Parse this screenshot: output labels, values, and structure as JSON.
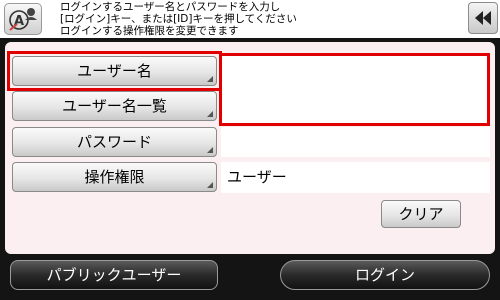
{
  "header": {
    "icon": "user-login-icon",
    "lines": [
      "ログインするユーザー名とパスワードを入力し",
      "[ログイン]キー、または[ID]キーを押してください",
      "ログインする操作権限を変更できます"
    ],
    "back_icon": "double-left-arrow-icon"
  },
  "form": {
    "username_button": "ユーザー名",
    "userlist_button": "ユーザー名一覧",
    "password_button": "パスワード",
    "authority_button": "操作権限",
    "username_value": "",
    "password_value": "",
    "authority_value": "ユーザー",
    "clear_button": "クリア"
  },
  "footer": {
    "public_user_button": "パブリックユーザー",
    "login_button": "ログイン"
  },
  "colors": {
    "highlight": "#e00000",
    "panel": "#fbeff2",
    "background": "#141414"
  }
}
